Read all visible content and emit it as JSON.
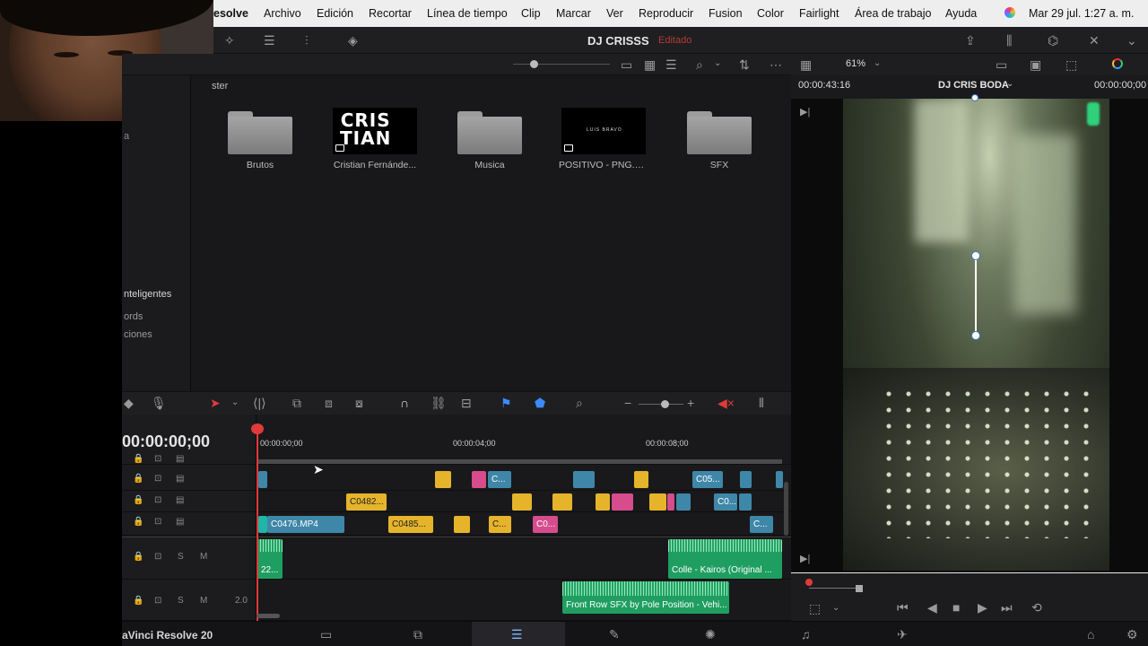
{
  "menu": {
    "app": "esolve",
    "items": [
      "Archivo",
      "Edición",
      "Recortar",
      "Línea de tiempo",
      "Clip",
      "Marcar",
      "Ver",
      "Reproducir",
      "Fusion",
      "Color",
      "Fairlight",
      "Área de trabajo",
      "Ayuda"
    ],
    "clock": "Mar 29 jul.  1:27 a. m."
  },
  "project": {
    "title": "DJ CRISSS",
    "status": "Editado"
  },
  "media_pool": {
    "path": "ster",
    "sidebar": {
      "smart_bins": "nteligentes",
      "keywords": "ords",
      "collections": "ciones",
      "top1": "a",
      "top0": ""
    },
    "clips": [
      {
        "name": "Brutos",
        "kind": "folder"
      },
      {
        "name": "Cristian Fernánde...",
        "kind": "image",
        "art": "CRIS\nTIAN"
      },
      {
        "name": "Musica",
        "kind": "folder"
      },
      {
        "name": "POSITIVO - PNG.png",
        "kind": "image",
        "art": "LUIS BRAVO"
      },
      {
        "name": "SFX",
        "kind": "folder"
      }
    ]
  },
  "viewer": {
    "zoom": "61%",
    "source_tc": "00:00:43:16",
    "timeline_name": "DJ CRIS BODA",
    "record_tc": "00:00:00;00"
  },
  "timeline": {
    "timecode": "00:00:00;00",
    "ruler": [
      "00:00:00;00",
      "00:00:04;00",
      "00:00:08;00"
    ],
    "clips": {
      "v3_1": "C...",
      "v3_2": "C05...",
      "v2_1": "C0482...",
      "v2_2": "C0...",
      "v1_1": "C0476.MP4",
      "v1_2": "C0485...",
      "v1_3": "C...",
      "v1_4": "C0...",
      "v1_5": "C..."
    },
    "audio": {
      "a1_left": "22...",
      "a1_right": "Colle - Kairos (Original ...",
      "a2": "Front Row SFX by Pole Position - Vehi...",
      "a2_channels": "2.0"
    },
    "track_buttons": {
      "solo": "S",
      "mute": "M"
    }
  },
  "footer": {
    "version": "aVinci Resolve 20"
  }
}
